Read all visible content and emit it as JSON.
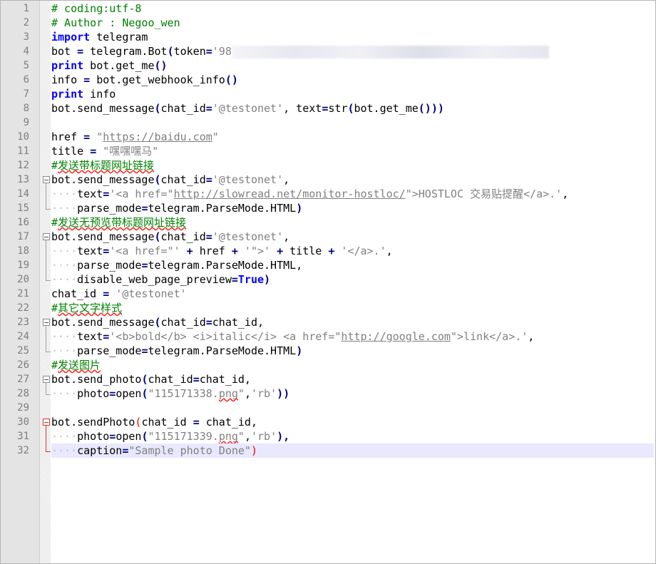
{
  "editor": {
    "lines": [
      {
        "n": "1",
        "fold": "",
        "tokens": [
          {
            "t": "# coding:utf-8",
            "c": "c"
          }
        ]
      },
      {
        "n": "2",
        "fold": "",
        "tokens": [
          {
            "t": "# Author : Negoo_wen",
            "c": "c"
          }
        ]
      },
      {
        "n": "3",
        "fold": "",
        "tokens": [
          {
            "t": "import",
            "c": "kw"
          },
          {
            "t": " telegram",
            "c": ""
          }
        ]
      },
      {
        "n": "4",
        "fold": "",
        "tokens": [
          {
            "t": "bot ",
            "c": ""
          },
          {
            "t": "=",
            "c": "op"
          },
          {
            "t": " telegram.Bot",
            "c": ""
          },
          {
            "t": "(",
            "c": "op"
          },
          {
            "t": "token",
            "c": ""
          },
          {
            "t": "=",
            "c": "op"
          },
          {
            "t": "'98",
            "c": "st"
          },
          {
            "t": "",
            "c": "redact"
          }
        ]
      },
      {
        "n": "5",
        "fold": "",
        "tokens": [
          {
            "t": "print",
            "c": "kw"
          },
          {
            "t": " bot.get_me",
            "c": ""
          },
          {
            "t": "()",
            "c": "op"
          }
        ]
      },
      {
        "n": "6",
        "fold": "",
        "tokens": [
          {
            "t": "info ",
            "c": ""
          },
          {
            "t": "=",
            "c": "op"
          },
          {
            "t": " bot.get_webhook_info",
            "c": ""
          },
          {
            "t": "()",
            "c": "op"
          }
        ]
      },
      {
        "n": "7",
        "fold": "",
        "tokens": [
          {
            "t": "print",
            "c": "kw"
          },
          {
            "t": " info",
            "c": ""
          }
        ]
      },
      {
        "n": "8",
        "fold": "",
        "tokens": [
          {
            "t": "bot.send_message",
            "c": ""
          },
          {
            "t": "(",
            "c": "op"
          },
          {
            "t": "chat_id",
            "c": ""
          },
          {
            "t": "=",
            "c": "op"
          },
          {
            "t": "'@testonet'",
            "c": "st"
          },
          {
            "t": ", text",
            "c": ""
          },
          {
            "t": "=",
            "c": "op"
          },
          {
            "t": "str",
            "c": ""
          },
          {
            "t": "(",
            "c": "op"
          },
          {
            "t": "bot.get_me",
            "c": ""
          },
          {
            "t": "()))",
            "c": "op"
          }
        ]
      },
      {
        "n": "9",
        "fold": "",
        "tokens": []
      },
      {
        "n": "10",
        "fold": "",
        "tokens": [
          {
            "t": "href ",
            "c": ""
          },
          {
            "t": "=",
            "c": "op"
          },
          {
            "t": " \"",
            "c": "st"
          },
          {
            "t": "https://baidu.com",
            "c": "st u"
          },
          {
            "t": "\"",
            "c": "st"
          }
        ]
      },
      {
        "n": "11",
        "fold": "",
        "tokens": [
          {
            "t": "title ",
            "c": ""
          },
          {
            "t": "=",
            "c": "op"
          },
          {
            "t": " \"嘿嘿嘿马\"",
            "c": "st"
          }
        ]
      },
      {
        "n": "12",
        "fold": "",
        "tokens": [
          {
            "t": "#",
            "c": "c"
          },
          {
            "t": "发送带标题网址链接",
            "c": "c sq"
          }
        ]
      },
      {
        "n": "13",
        "fold": "box",
        "tokens": [
          {
            "t": "bot.send_message",
            "c": ""
          },
          {
            "t": "(",
            "c": "op"
          },
          {
            "t": "chat_id",
            "c": ""
          },
          {
            "t": "=",
            "c": "op"
          },
          {
            "t": "'@testonet'",
            "c": "st"
          },
          {
            "t": ",",
            "c": ""
          }
        ]
      },
      {
        "n": "14",
        "fold": "line-v",
        "tokens": [
          {
            "t": "····",
            "c": "ws"
          },
          {
            "t": "text",
            "c": ""
          },
          {
            "t": "=",
            "c": "op"
          },
          {
            "t": "'<a href=\"",
            "c": "st"
          },
          {
            "t": "http://slowread.net/monitor-hostloc/",
            "c": "st u"
          },
          {
            "t": "\">HOSTLOC 交易贴提醒</a>.'",
            "c": "st"
          },
          {
            "t": ",",
            "c": ""
          }
        ]
      },
      {
        "n": "15",
        "fold": "end",
        "tokens": [
          {
            "t": "····",
            "c": "ws"
          },
          {
            "t": "parse_mode",
            "c": ""
          },
          {
            "t": "=",
            "c": "op"
          },
          {
            "t": "telegram.ParseMode.HTML",
            "c": ""
          },
          {
            "t": ")",
            "c": "op"
          }
        ]
      },
      {
        "n": "16",
        "fold": "",
        "tokens": [
          {
            "t": "#",
            "c": "c"
          },
          {
            "t": "发送无预览带标题网址链接",
            "c": "c sq"
          }
        ]
      },
      {
        "n": "17",
        "fold": "box",
        "tokens": [
          {
            "t": "bot.send_message",
            "c": ""
          },
          {
            "t": "(",
            "c": "op"
          },
          {
            "t": "chat_id",
            "c": ""
          },
          {
            "t": "=",
            "c": "op"
          },
          {
            "t": "'@testonet'",
            "c": "st"
          },
          {
            "t": ",",
            "c": ""
          }
        ]
      },
      {
        "n": "18",
        "fold": "line-v",
        "tokens": [
          {
            "t": "····",
            "c": "ws"
          },
          {
            "t": "text",
            "c": ""
          },
          {
            "t": "=",
            "c": "op"
          },
          {
            "t": "'<a href=\"' ",
            "c": "st"
          },
          {
            "t": "+",
            "c": "op"
          },
          {
            "t": " href ",
            "c": ""
          },
          {
            "t": "+",
            "c": "op"
          },
          {
            "t": " '\">' ",
            "c": "st"
          },
          {
            "t": "+",
            "c": "op"
          },
          {
            "t": " title ",
            "c": ""
          },
          {
            "t": "+",
            "c": "op"
          },
          {
            "t": " '</a>.'",
            "c": "st"
          },
          {
            "t": ",",
            "c": ""
          }
        ]
      },
      {
        "n": "19",
        "fold": "line-v",
        "tokens": [
          {
            "t": "····",
            "c": "ws"
          },
          {
            "t": "parse_mode",
            "c": ""
          },
          {
            "t": "=",
            "c": "op"
          },
          {
            "t": "telegram.ParseMode.HTML,",
            "c": ""
          }
        ]
      },
      {
        "n": "20",
        "fold": "end",
        "tokens": [
          {
            "t": "····",
            "c": "ws"
          },
          {
            "t": "disable_web_page_preview",
            "c": ""
          },
          {
            "t": "=",
            "c": "op"
          },
          {
            "t": "True",
            "c": "kw"
          },
          {
            "t": ")",
            "c": "op"
          }
        ]
      },
      {
        "n": "21",
        "fold": "",
        "tokens": [
          {
            "t": "chat_id ",
            "c": ""
          },
          {
            "t": "=",
            "c": "op"
          },
          {
            "t": " '@testonet'",
            "c": "st"
          }
        ]
      },
      {
        "n": "22",
        "fold": "",
        "tokens": [
          {
            "t": "#",
            "c": "c"
          },
          {
            "t": "其它文字样式",
            "c": "c sq"
          }
        ]
      },
      {
        "n": "23",
        "fold": "box",
        "tokens": [
          {
            "t": "bot.send_message",
            "c": ""
          },
          {
            "t": "(",
            "c": "op"
          },
          {
            "t": "chat_id",
            "c": ""
          },
          {
            "t": "=",
            "c": "op"
          },
          {
            "t": "chat_id,",
            "c": ""
          }
        ]
      },
      {
        "n": "24",
        "fold": "line-v",
        "tokens": [
          {
            "t": "····",
            "c": "ws"
          },
          {
            "t": "text",
            "c": ""
          },
          {
            "t": "=",
            "c": "op"
          },
          {
            "t": "'<b>bold</b> <i>italic</i> <a href=\"",
            "c": "st"
          },
          {
            "t": "http://google.com",
            "c": "st u"
          },
          {
            "t": "\">link</a>.'",
            "c": "st"
          },
          {
            "t": ",",
            "c": ""
          }
        ]
      },
      {
        "n": "25",
        "fold": "end",
        "tokens": [
          {
            "t": "····",
            "c": "ws"
          },
          {
            "t": "parse_mode",
            "c": ""
          },
          {
            "t": "=",
            "c": "op"
          },
          {
            "t": "telegram.ParseMode.HTML",
            "c": ""
          },
          {
            "t": ")",
            "c": "op"
          }
        ]
      },
      {
        "n": "26",
        "fold": "",
        "tokens": [
          {
            "t": "#",
            "c": "c"
          },
          {
            "t": "发送图片",
            "c": "c sq"
          }
        ]
      },
      {
        "n": "27",
        "fold": "box",
        "tokens": [
          {
            "t": "bot.send_photo",
            "c": ""
          },
          {
            "t": "(",
            "c": "op"
          },
          {
            "t": "chat_id",
            "c": ""
          },
          {
            "t": "=",
            "c": "op"
          },
          {
            "t": "chat_id,",
            "c": ""
          }
        ]
      },
      {
        "n": "28",
        "fold": "end",
        "tokens": [
          {
            "t": "····",
            "c": "ws"
          },
          {
            "t": "photo",
            "c": ""
          },
          {
            "t": "=",
            "c": "op"
          },
          {
            "t": "open",
            "c": ""
          },
          {
            "t": "(",
            "c": "op"
          },
          {
            "t": "\"115171338.",
            "c": "st"
          },
          {
            "t": "png",
            "c": "st sq"
          },
          {
            "t": "\"",
            "c": "st"
          },
          {
            "t": ",",
            "c": ""
          },
          {
            "t": "'rb'",
            "c": "st"
          },
          {
            "t": "))",
            "c": "op"
          }
        ]
      },
      {
        "n": "29",
        "fold": "",
        "tokens": []
      },
      {
        "n": "30",
        "fold": "box red",
        "tokens": [
          {
            "t": "bot.sendPhoto",
            "c": ""
          },
          {
            "t": "(",
            "c": "brace-hl"
          },
          {
            "t": "chat_id ",
            "c": ""
          },
          {
            "t": "=",
            "c": "op"
          },
          {
            "t": " chat_id,",
            "c": ""
          }
        ]
      },
      {
        "n": "31",
        "fold": "line-v red",
        "tokens": [
          {
            "t": "····",
            "c": "ws"
          },
          {
            "t": "photo",
            "c": ""
          },
          {
            "t": "=",
            "c": "op"
          },
          {
            "t": "open",
            "c": ""
          },
          {
            "t": "(",
            "c": "op"
          },
          {
            "t": "\"115171339.",
            "c": "st"
          },
          {
            "t": "png",
            "c": "st sq"
          },
          {
            "t": "\"",
            "c": "st"
          },
          {
            "t": ",",
            "c": ""
          },
          {
            "t": "'rb'",
            "c": "st"
          },
          {
            "t": "),",
            "c": "op"
          }
        ]
      },
      {
        "n": "32",
        "fold": "end red",
        "current": true,
        "tokens": [
          {
            "t": "····",
            "c": "ws"
          },
          {
            "t": "caption",
            "c": ""
          },
          {
            "t": "=",
            "c": "op"
          },
          {
            "t": "\"Sample photo Done\"",
            "c": "st"
          },
          {
            "t": ")",
            "c": "brace-hl"
          }
        ]
      }
    ]
  }
}
